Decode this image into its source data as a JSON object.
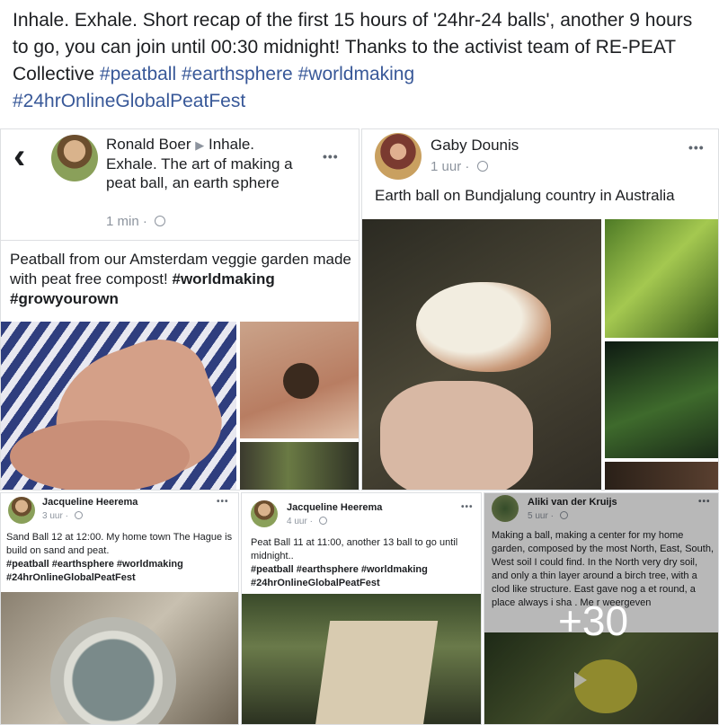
{
  "caption": {
    "text": "Inhale. Exhale. Short recap of the first 15 hours of '24hr-24 balls', another 9 hours to go, you can join until 00:30 midnight! Thanks to the activist team of RE-PEAT Collective",
    "tags": [
      "#peatball",
      "#earthsphere",
      "#worldmaking",
      "#24hrOnlineGlobalPeatFest"
    ]
  },
  "post1": {
    "author": "Ronald Boer",
    "arrow": "▶",
    "title": "Inhale. Exhale. The art of making a peat ball, an earth sphere",
    "time": "1 min",
    "dot": "·",
    "more": "•••",
    "back": "‹",
    "body": "Peatball from our Amsterdam veggie garden made with peat free compost!",
    "tags": [
      "#worldmaking",
      "#growyourown"
    ]
  },
  "post2": {
    "author": "Gaby Dounis",
    "time": "1 uur",
    "dot": "·",
    "more": "•••",
    "body": "Earth ball on Bundjalung country in Australia"
  },
  "post3": {
    "author": "Jacqueline Heerema",
    "time": "3 uur",
    "dot": "·",
    "more": "•••",
    "body": "Sand Ball 12 at 12:00. My home town The Hague is build on sand and peat.",
    "tags": "#peatball #earthsphere #worldmaking #24hrOnlineGlobalPeatFest"
  },
  "post4": {
    "author": "Jacqueline Heerema",
    "time": "4 uur",
    "dot": "·",
    "more": "•••",
    "body": "Peat Ball 11 at 11:00, another 13 ball to go until midnight..",
    "tags": "#peatball #earthsphere #worldmaking #24hrOnlineGlobalPeatFest"
  },
  "post5": {
    "author": "Aliki van der Kruijs",
    "time": "5 uur",
    "dot": "·",
    "more": "•••",
    "body": "Making a ball, making a center for my home garden, composed by the most North, East, South, West soil I could find. In the North very dry soil, and only a thin layer around a birch tree, with a clod like structure. East gave nog a et round, a place always i sha . Me r weergeven",
    "overlay": "+30"
  }
}
